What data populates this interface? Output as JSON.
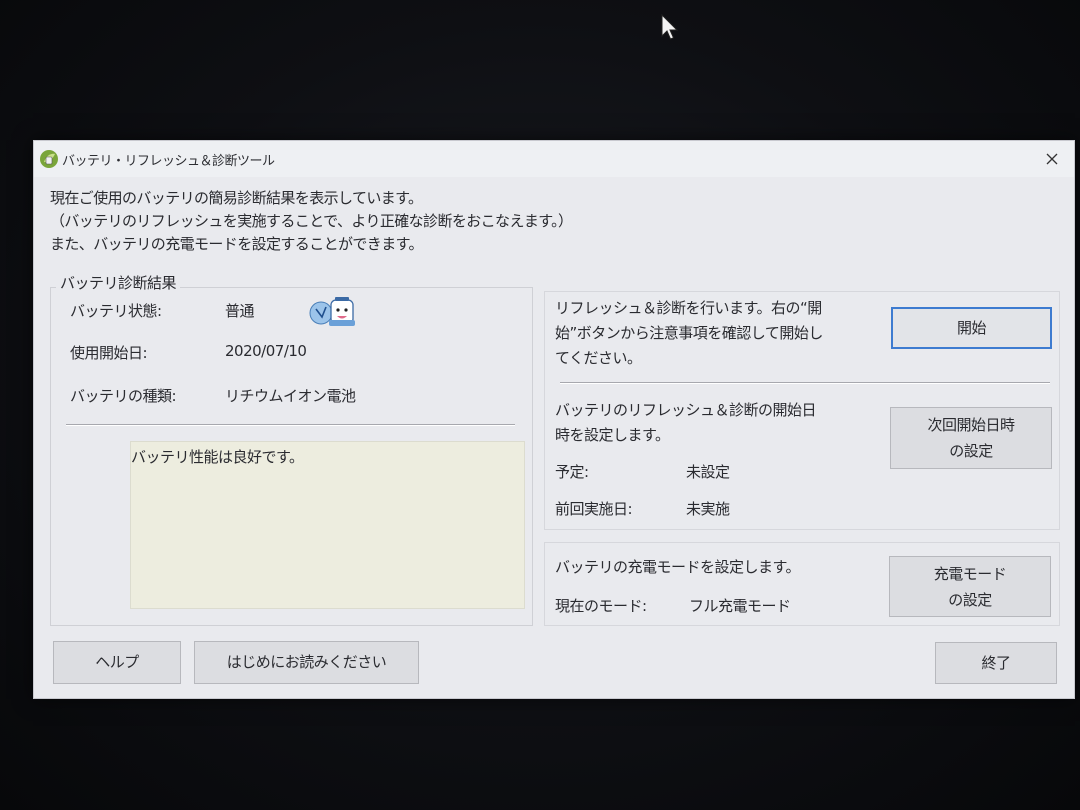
{
  "window": {
    "title": "バッテリ・リフレッシュ＆診断ツール"
  },
  "intro": {
    "line1": "現在ご使用のバッテリの簡易診断結果を表示しています。",
    "line2": "（バッテリのリフレッシュを実施することで、より正確な診断をおこなえます。）",
    "line3": "また、バッテリの充電モードを設定することができます。"
  },
  "diagnosis": {
    "group_title": "バッテリ診断結果",
    "status_label": "バッテリ状態:",
    "status_value": "普通",
    "status_icon": "battery-character-icon",
    "start_date_label": "使用開始日:",
    "start_date_value": "2020/07/10",
    "type_label": "バッテリの種類:",
    "type_value": "リチウムイオン電池",
    "result_text": "バッテリ性能は良好です。"
  },
  "refresh": {
    "description_line1": "リフレッシュ＆診断を行います。右の“開",
    "description_line2": "始”ボタンから注意事項を確認して開始し",
    "description_line3": "てください。",
    "start_button": "開始"
  },
  "schedule": {
    "description_line1": "バッテリのリフレッシュ＆診断の開始日",
    "description_line2": "時を設定します。",
    "planned_label": "予定:",
    "planned_value": "未設定",
    "last_run_label": "前回実施日:",
    "last_run_value": "未実施",
    "button_line1": "次回開始日時",
    "button_line2": "の設定"
  },
  "charge_mode": {
    "description": "バッテリの充電モードを設定します。",
    "current_label": "現在のモード:",
    "current_value": "フル充電モード",
    "button_line1": "充電モード",
    "button_line2": "の設定"
  },
  "footer": {
    "help_button": "ヘルプ",
    "readme_button": "はじめにお読みください",
    "exit_button": "終了"
  },
  "colors": {
    "window_bg": "#e9eaee",
    "button_bg": "#dcdde1",
    "focus_border": "#3d7bd0",
    "result_bg": "#ededdf"
  }
}
